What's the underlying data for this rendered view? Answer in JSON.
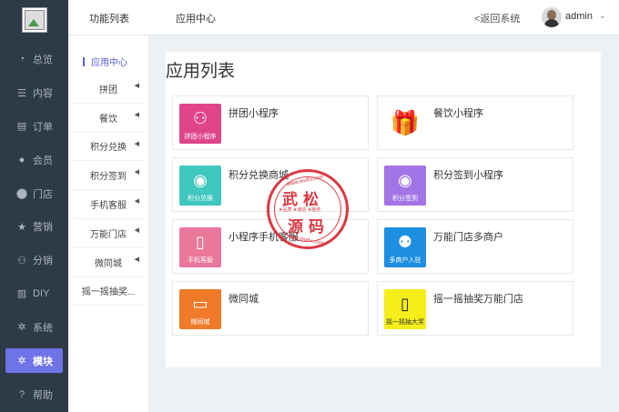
{
  "sidebar": {
    "items": [
      {
        "icon": "pie-chart-icon",
        "glyph": "◔",
        "label": "总览"
      },
      {
        "icon": "list-icon",
        "glyph": "☰",
        "label": "内容"
      },
      {
        "icon": "document-icon",
        "glyph": "▤",
        "label": "订单"
      },
      {
        "icon": "user-icon",
        "glyph": "●",
        "label": "会员"
      },
      {
        "icon": "location-pin-icon",
        "glyph": "⬤",
        "label": "门店"
      },
      {
        "icon": "star-icon",
        "glyph": "★",
        "label": "营销"
      },
      {
        "icon": "users-icon",
        "glyph": "⚇",
        "label": "分销"
      },
      {
        "icon": "layout-icon",
        "glyph": "▥",
        "label": "DIY"
      },
      {
        "icon": "gear-icon",
        "glyph": "✲",
        "label": "系统"
      },
      {
        "icon": "module-gear-icon",
        "glyph": "✲",
        "label": "模块",
        "active": true
      },
      {
        "icon": "help-icon",
        "glyph": "?",
        "label": "帮助"
      }
    ]
  },
  "topbar": {
    "section_title": "功能列表",
    "page_title": "应用中心",
    "back_link": "<返回系统",
    "user_name": "admin",
    "caret": "⌄"
  },
  "subnav": {
    "title": "应用中心",
    "items": [
      "拼团",
      "餐饮",
      "积分兑换",
      "积分签到",
      "手机客服",
      "万能门店",
      "微同城",
      "摇一摇抽奖..."
    ]
  },
  "main": {
    "heading": "应用列表",
    "apps": [
      {
        "name": "拼团小程序",
        "tile_label": "拼团小程序",
        "glyph": "⚇",
        "color": "#e0458a"
      },
      {
        "name": "餐饮小程序",
        "tile_label": "",
        "glyph": "🎁",
        "color": "#ffffff"
      },
      {
        "name": "积分兑换商城",
        "tile_label": "积分兑换",
        "glyph": "◉",
        "color": "#3fc7c0"
      },
      {
        "name": "积分签到小程序",
        "tile_label": "积分签到",
        "glyph": "◉",
        "color": "#a374e6"
      },
      {
        "name": "小程序手机客服",
        "tile_label": "手机客服",
        "glyph": "▯",
        "color": "#e9789b"
      },
      {
        "name": "万能门店多商户",
        "tile_label": "多商户入驻",
        "glyph": "⚉",
        "color": "#1d8fe0"
      },
      {
        "name": "微同城",
        "tile_label": "微同城",
        "glyph": "▭",
        "color": "#f07a2a"
      },
      {
        "name": "摇一摇抽奖万能门店",
        "tile_label": "摇一摇抽大奖",
        "glyph": "▯",
        "color": "#f5ee1a"
      }
    ]
  },
  "watermark": {
    "line1": "武松",
    "line2": "源码",
    "middle": "★品质 ★诚信 ★服务",
    "url_top": "www.wu6v.com",
    "url_bottom": "www.wu6v.com"
  }
}
